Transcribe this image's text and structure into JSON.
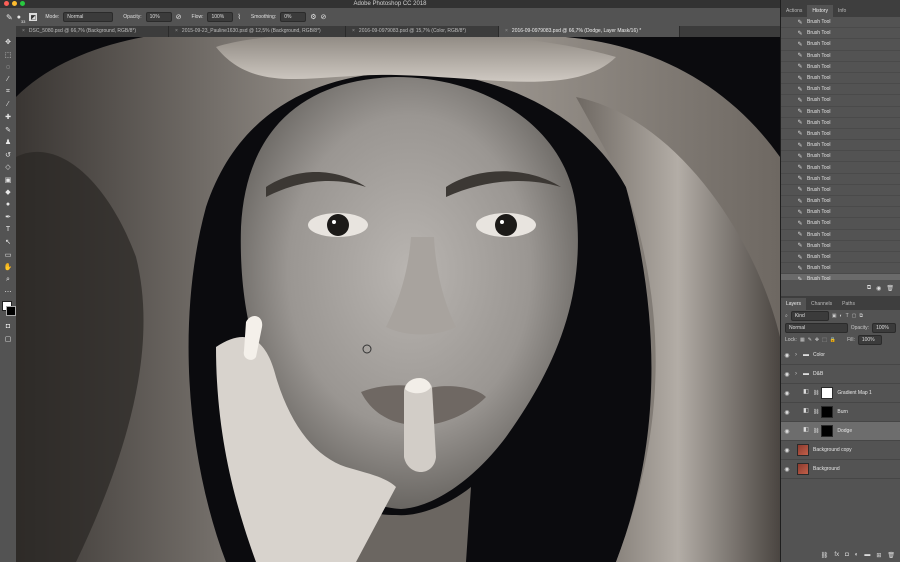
{
  "app": {
    "title": "Adobe Photoshop CC 2018"
  },
  "options_bar": {
    "mode_label": "Mode:",
    "mode_value": "Normal",
    "opacity_label": "Opacity:",
    "opacity_value": "10%",
    "flow_label": "Flow:",
    "flow_value": "100%",
    "smoothing_label": "Smoothing:",
    "smoothing_value": "0%",
    "brush_size": "33"
  },
  "tabs": [
    {
      "label": "DSC_5080.psd @ 66,7% (Background, RGB/8*)"
    },
    {
      "label": "2015-09-23_Pauline1630.psd @ 12,5% (Background, RGB/8*)"
    },
    {
      "label": "2016-09-0979083.psd @ 15,7% (Color, RGB/8*)"
    },
    {
      "label": "2016-09-0979083.psd @ 66,7% (Dodge, Layer Mask/16) *"
    }
  ],
  "top_panels": {
    "tabs": [
      "Actions",
      "History",
      "Info"
    ],
    "active": "History"
  },
  "history": {
    "items": [
      "Brush Tool",
      "Brush Tool",
      "Brush Tool",
      "Brush Tool",
      "Brush Tool",
      "Brush Tool",
      "Brush Tool",
      "Brush Tool",
      "Brush Tool",
      "Brush Tool",
      "Brush Tool",
      "Brush Tool",
      "Brush Tool",
      "Brush Tool",
      "Brush Tool",
      "Brush Tool",
      "Brush Tool",
      "Brush Tool",
      "Brush Tool",
      "Brush Tool",
      "Brush Tool",
      "Brush Tool",
      "Brush Tool",
      "Brush Tool"
    ]
  },
  "layers_panel": {
    "tabs": [
      "Layers",
      "Channels",
      "Paths"
    ],
    "active": "Layers",
    "filter": "Kind",
    "blend_mode": "Normal",
    "opacity_label": "Opacity:",
    "opacity_value": "100%",
    "lock_label": "Lock:",
    "fill_label": "Fill:",
    "fill_value": "100%",
    "layers": [
      {
        "name": "Color",
        "type": "group"
      },
      {
        "name": "D&B",
        "type": "group"
      },
      {
        "name": "Gradient Map 1",
        "type": "adjustment"
      },
      {
        "name": "Burn",
        "type": "adjustment"
      },
      {
        "name": "Dodge",
        "type": "adjustment",
        "selected": true
      },
      {
        "name": "Background copy",
        "type": "image"
      },
      {
        "name": "Background",
        "type": "image"
      }
    ]
  },
  "colors": {
    "ui_dark": "#323232",
    "ui_panel": "#535353",
    "selected": "#6d6d6d"
  }
}
